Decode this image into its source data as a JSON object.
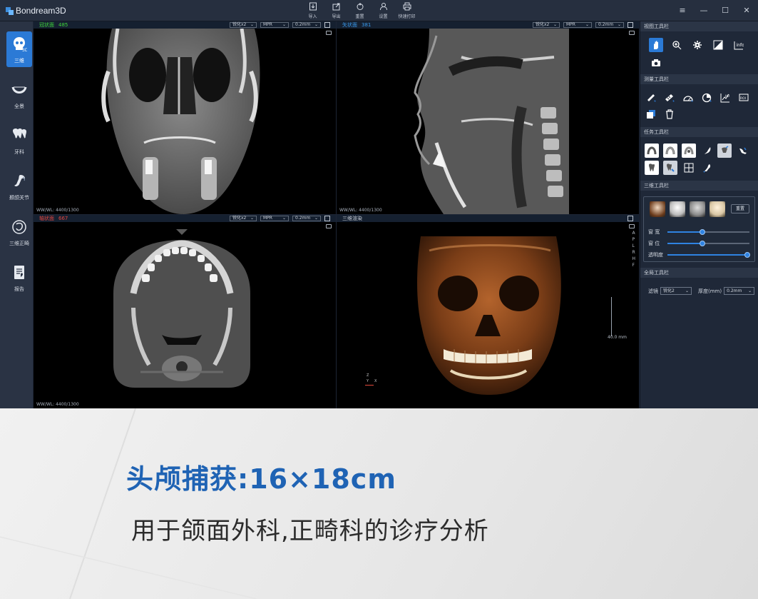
{
  "app": {
    "name": "Bondream3D",
    "toolbar": [
      {
        "label": "导入",
        "icon": "import-icon"
      },
      {
        "label": "导出",
        "icon": "export-icon"
      },
      {
        "label": "重置",
        "icon": "reset-icon"
      },
      {
        "label": "设置",
        "icon": "settings-icon"
      },
      {
        "label": "快速打印",
        "icon": "print-icon"
      }
    ],
    "window_controls": {
      "menu": "≡",
      "minimize": "—",
      "maximize": "☐",
      "close": "✕"
    }
  },
  "nav": [
    {
      "label": "三维",
      "icon": "skull-3d-icon",
      "active": true
    },
    {
      "label": "全景",
      "icon": "panorama-arch-icon",
      "active": false
    },
    {
      "label": "牙科",
      "icon": "tooth-icon",
      "active": false
    },
    {
      "label": "颞颌关节",
      "icon": "tmj-joint-icon",
      "active": false
    },
    {
      "label": "三维正畸",
      "icon": "ortho-3d-icon",
      "active": false
    },
    {
      "label": "报告",
      "icon": "report-icon",
      "active": false
    }
  ],
  "viewports": {
    "coronal": {
      "title": "冠状面",
      "slice": "485",
      "title_color": "#3fd43b",
      "filter": "锐化x2",
      "mode": "MPR",
      "thickness": "0.2mm",
      "wwwl": "WW/WL: 4400/1300"
    },
    "sagittal": {
      "title": "矢状面",
      "slice": "381",
      "title_color": "#3a9cf0",
      "filter": "锐化x2",
      "mode": "MPR",
      "thickness": "0.2mm",
      "wwwl": "WW/WL: 4400/1300"
    },
    "axial": {
      "title": "轴状面",
      "slice": "667",
      "title_color": "#e2463f",
      "filter": "锐化x2",
      "mode": "MPR",
      "thickness": "0.2mm",
      "wwwl": "WW/WL: 4400/1300"
    },
    "render3d": {
      "title": "三维渲染",
      "orientation": [
        "A",
        "P",
        "L",
        "R",
        "H",
        "F"
      ],
      "scale_label": "40.0 mm",
      "axes": {
        "z": "Z",
        "y": "Y",
        "x": "X"
      }
    }
  },
  "right_panel": {
    "view_tools": {
      "title": "视图工具栏",
      "items": [
        "pan-hand-icon",
        "zoom-icon",
        "settings-gear-icon",
        "invert-contrast-icon",
        "info-icon",
        "camera-icon"
      ]
    },
    "measure_tools": {
      "title": "测量工具栏",
      "items": [
        "ruler-icon",
        "caliper-icon",
        "angle-protractor-icon",
        "area-pie-icon",
        "histogram-icon",
        "roi-icon",
        "copy-icon",
        "trash-icon"
      ]
    },
    "task_tools": {
      "title": "任务工具栏",
      "items": [
        "arch-curve-icon",
        "arch-curve-2-icon",
        "arch-panorama-icon",
        "nerve-canal-icon",
        "implant-icon",
        "airway-icon",
        "tooth-segment-icon",
        "tooth-annotate-icon",
        "grid-icon",
        "tmj-icon"
      ]
    },
    "render_tools": {
      "title": "三维工具栏",
      "presets": [
        "skull-skin-preset",
        "skull-bone-preset",
        "skull-gray-preset",
        "skull-soft-preset"
      ],
      "reset_label": "重置",
      "sliders": [
        {
          "label": "窗 宽",
          "value": 0.43
        },
        {
          "label": "窗 位",
          "value": 0.43
        },
        {
          "label": "透明度",
          "value": 0.97
        }
      ]
    },
    "global_tools": {
      "title": "全局工具栏",
      "filter_label": "滤镜",
      "filter_value": "锐化2",
      "thickness_label": "厚度(mm)",
      "thickness_value": "0.2mm"
    }
  },
  "banner": {
    "headline": "头颅捕获:16×18cm",
    "subline": "用于颌面外科,正畸科的诊疗分析",
    "headline_color": "#1f63b4"
  }
}
